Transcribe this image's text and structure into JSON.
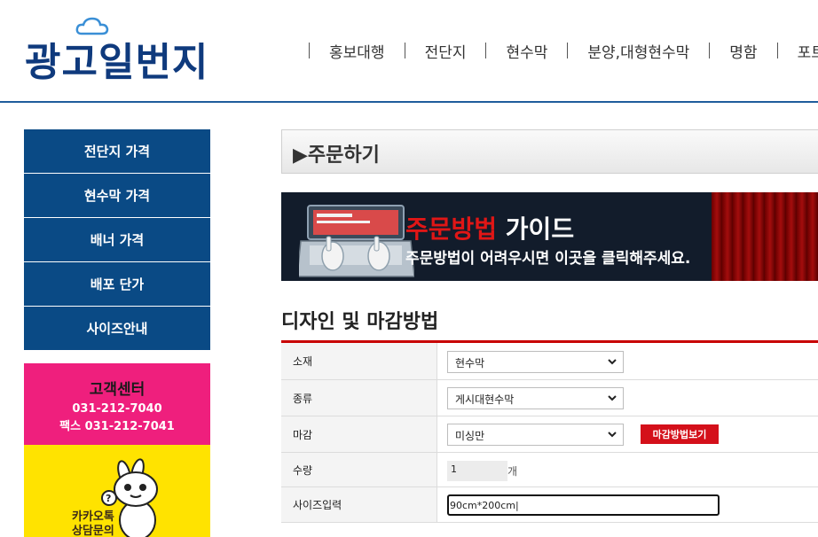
{
  "header": {
    "logo_text": "광고일번지",
    "nav": [
      "홍보대행",
      "전단지",
      "현수막",
      "분양,대형현수막",
      "명함",
      "포트"
    ]
  },
  "sidebar": {
    "items": [
      "전단지 가격",
      "현수막 가격",
      "배너 가격",
      "배포 단가",
      "사이즈안내"
    ],
    "cs": {
      "title": "고객센터",
      "phone": "031-212-7040",
      "fax": "팩스 031-212-7041"
    },
    "kakao": {
      "line1": "카카오톡",
      "line2": "상담문의"
    }
  },
  "main": {
    "section_title": "▶주문하기",
    "banner": {
      "title_red": "주문방법",
      "title_white": " 가이드",
      "subtitle": "주문방법이 어려우시면 이곳을 클릭해주세요."
    },
    "form_heading": "디자인 및 마감방법",
    "form": {
      "material_label": "소재",
      "material_value": "현수막",
      "type_label": "종류",
      "type_value": "게시대현수막",
      "finish_label": "마감",
      "finish_value": "미싱만",
      "finish_button": "마감방법보기",
      "quantity_label": "수량",
      "quantity_value": "1",
      "quantity_unit": "개",
      "size_label": "사이즈입력",
      "size_value": "90cm*200cm|"
    }
  },
  "colors": {
    "sidebar_blue": "#0a4a85",
    "cs_pink": "#ef1f7d",
    "kakao_yellow": "#ffe300",
    "accent_red": "#c80000",
    "logo_blue": "#0f3a7d"
  }
}
